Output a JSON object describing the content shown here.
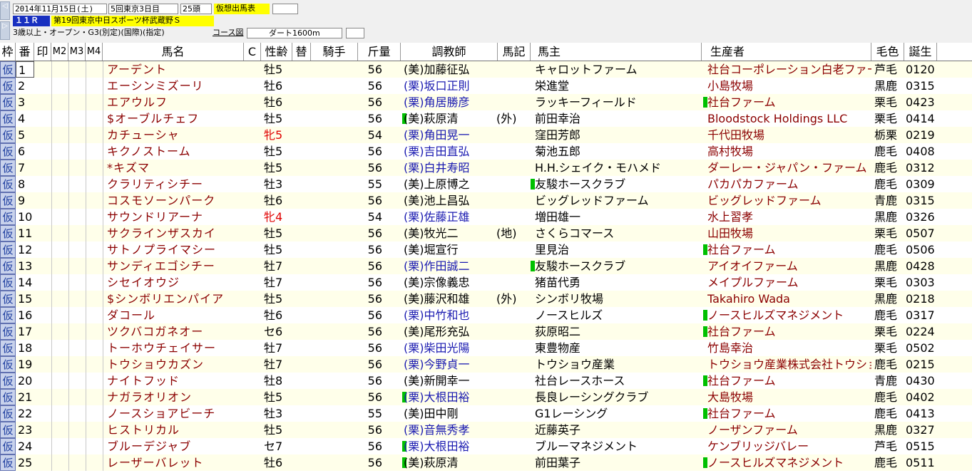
{
  "header": {
    "nav_left_top": "◁",
    "nav_left_bottom": "▷",
    "date": "2014年11月15日(土)",
    "meeting": "5回東京3日目",
    "runners": "25頭",
    "status_badge": "仮想出馬表",
    "race_no": "１１Ｒ",
    "race_name": "第19回東京中日スポーツ杯武蔵野Ｓ",
    "conditions": "3歳以上・オープン・G3(別定)(国際)(指定)",
    "course_label": "コース図",
    "course": "ダート1600m",
    "badge_color": "#ffff00",
    "race_color": "#1830c0"
  },
  "columns": [
    "枠",
    "番",
    "印",
    "M2",
    "M3",
    "M4",
    "馬名",
    "C",
    "性齢",
    "替",
    "騎手",
    "斤量",
    "調教師",
    "馬記",
    "馬主",
    "生産者",
    "毛色",
    "誕生"
  ],
  "rows": [
    {
      "waku": "仮",
      "ban": "1",
      "name": "アーデント",
      "sex": "牡5",
      "kin": "56",
      "g1": false,
      "trainer": "(美)加藤征弘",
      "tblue": false,
      "note": "",
      "owner": "キャロットファーム",
      "g2": false,
      "breeder": "社台コーポレーション白老ファー",
      "coat": "芦毛",
      "bday": "0120"
    },
    {
      "waku": "仮",
      "ban": "2",
      "name": "エーシンミズーリ",
      "sex": "牡6",
      "kin": "56",
      "g1": false,
      "trainer": "(栗)坂口正則",
      "tblue": true,
      "note": "",
      "owner": "栄進堂",
      "g2": false,
      "breeder": "小島牧場",
      "coat": "黒鹿",
      "bday": "0315"
    },
    {
      "waku": "仮",
      "ban": "3",
      "name": "エアウルフ",
      "sex": "牡6",
      "kin": "56",
      "g1": false,
      "trainer": "(栗)角居勝彦",
      "tblue": true,
      "note": "",
      "owner": "ラッキーフィールド",
      "g2": true,
      "breeder": "社台ファーム",
      "coat": "栗毛",
      "bday": "0423"
    },
    {
      "waku": "仮",
      "ban": "4",
      "name": "$オーブルチェフ",
      "sex": "牡5",
      "kin": "56",
      "g1": true,
      "trainer": "(美)萩原清",
      "tblue": false,
      "note": "(外)",
      "owner": "前田幸治",
      "g2": false,
      "breeder": "Bloodstock Holdings LLC",
      "coat": "栗毛",
      "bday": "0414"
    },
    {
      "waku": "仮",
      "ban": "5",
      "name": "カチューシャ",
      "sex": "牝5",
      "kin": "54",
      "g1": false,
      "trainer": "(栗)角田晃一",
      "tblue": true,
      "note": "",
      "owner": "窪田芳郎",
      "g2": false,
      "breeder": "千代田牧場",
      "coat": "栃栗",
      "bday": "0219"
    },
    {
      "waku": "仮",
      "ban": "6",
      "name": "キクノストーム",
      "sex": "牡5",
      "kin": "56",
      "g1": false,
      "trainer": "(栗)吉田直弘",
      "tblue": true,
      "note": "",
      "owner": "菊池五郎",
      "g2": false,
      "breeder": "高村牧場",
      "coat": "鹿毛",
      "bday": "0408"
    },
    {
      "waku": "仮",
      "ban": "7",
      "name": "*キズマ",
      "sex": "牡5",
      "kin": "56",
      "g1": false,
      "trainer": "(栗)白井寿昭",
      "tblue": true,
      "note": "",
      "owner": "H.H.シェイク・モハメド",
      "g2": false,
      "breeder": "ダーレー・ジャパン・ファーム",
      "coat": "鹿毛",
      "bday": "0312"
    },
    {
      "waku": "仮",
      "ban": "8",
      "name": "クラリティシチー",
      "sex": "牡3",
      "kin": "55",
      "g1": false,
      "trainer": "(美)上原博之",
      "tblue": false,
      "note": "",
      "owner": "友駿ホースクラブ",
      "g2": false,
      "g3": true,
      "breeder": "パカパカファーム",
      "coat": "鹿毛",
      "bday": "0309"
    },
    {
      "waku": "仮",
      "ban": "9",
      "name": "コスモソーンパーク",
      "sex": "牡6",
      "kin": "56",
      "g1": false,
      "trainer": "(美)池上昌弘",
      "tblue": false,
      "note": "",
      "owner": "ビッグレッドファーム",
      "g2": false,
      "breeder": "ビッグレッドファーム",
      "coat": "青鹿",
      "bday": "0315"
    },
    {
      "waku": "仮",
      "ban": "10",
      "name": "サウンドリアーナ",
      "sex": "牝4",
      "kin": "54",
      "g1": false,
      "trainer": "(栗)佐藤正雄",
      "tblue": true,
      "note": "",
      "owner": "増田雄一",
      "g2": false,
      "breeder": "水上習孝",
      "coat": "黒鹿",
      "bday": "0326"
    },
    {
      "waku": "仮",
      "ban": "11",
      "name": "サクラインザスカイ",
      "sex": "牡5",
      "kin": "56",
      "g1": false,
      "trainer": "(美)牧光二",
      "tblue": false,
      "note": "(地)",
      "owner": "さくらコマース",
      "g2": false,
      "breeder": "山田牧場",
      "coat": "栗毛",
      "bday": "0507"
    },
    {
      "waku": "仮",
      "ban": "12",
      "name": "サトノプライマシー",
      "sex": "牡5",
      "kin": "56",
      "g1": false,
      "trainer": "(美)堀宣行",
      "tblue": false,
      "note": "",
      "owner": "里見治",
      "g2": true,
      "breeder": "社台ファーム",
      "coat": "鹿毛",
      "bday": "0506"
    },
    {
      "waku": "仮",
      "ban": "13",
      "name": "サンディエゴシチー",
      "sex": "牡7",
      "kin": "56",
      "g1": false,
      "trainer": "(栗)作田誠二",
      "tblue": true,
      "note": "",
      "owner": "友駿ホースクラブ",
      "g2": false,
      "g3": true,
      "breeder": "アイオイファーム",
      "coat": "黒鹿",
      "bday": "0428"
    },
    {
      "waku": "仮",
      "ban": "14",
      "name": "シセイオウジ",
      "sex": "牡7",
      "kin": "56",
      "g1": false,
      "trainer": "(美)宗像義忠",
      "tblue": false,
      "note": "",
      "owner": "猪苗代勇",
      "g2": false,
      "breeder": "メイプルファーム",
      "coat": "栗毛",
      "bday": "0303"
    },
    {
      "waku": "仮",
      "ban": "15",
      "name": "$シンボリエンパイア",
      "sex": "牡5",
      "kin": "56",
      "g1": false,
      "trainer": "(美)藤沢和雄",
      "tblue": false,
      "note": "(外)",
      "owner": "シンボリ牧場",
      "g2": false,
      "breeder": "Takahiro Wada",
      "coat": "黒鹿",
      "bday": "0218"
    },
    {
      "waku": "仮",
      "ban": "16",
      "name": "ダコール",
      "sex": "牡6",
      "kin": "56",
      "g1": false,
      "trainer": "(栗)中竹和也",
      "tblue": true,
      "note": "",
      "owner": "ノースヒルズ",
      "g2": true,
      "breeder": "ノースヒルズマネジメント",
      "coat": "鹿毛",
      "bday": "0317"
    },
    {
      "waku": "仮",
      "ban": "17",
      "name": "ツクバコガネオー",
      "sex": "セ6",
      "kin": "56",
      "g1": false,
      "trainer": "(美)尾形充弘",
      "tblue": false,
      "note": "",
      "owner": "荻原昭二",
      "g2": true,
      "breeder": "社台ファーム",
      "coat": "栗毛",
      "bday": "0224"
    },
    {
      "waku": "仮",
      "ban": "18",
      "name": "トーホウチェイサー",
      "sex": "牡7",
      "kin": "56",
      "g1": false,
      "trainer": "(栗)柴田光陽",
      "tblue": true,
      "note": "",
      "owner": "東豊物産",
      "g2": false,
      "breeder": "竹島幸治",
      "coat": "栗毛",
      "bday": "0502"
    },
    {
      "waku": "仮",
      "ban": "19",
      "name": "トウショウカズン",
      "sex": "牡7",
      "kin": "56",
      "g1": false,
      "trainer": "(栗)今野貞一",
      "tblue": true,
      "note": "",
      "owner": "トウショウ産業",
      "g2": false,
      "breeder": "トウショウ産業株式会社トウショ",
      "coat": "鹿毛",
      "bday": "0215"
    },
    {
      "waku": "仮",
      "ban": "20",
      "name": "ナイトフッド",
      "sex": "牡8",
      "kin": "56",
      "g1": false,
      "trainer": "(美)新開幸一",
      "tblue": false,
      "note": "",
      "owner": "社台レースホース",
      "g2": true,
      "breeder": "社台ファーム",
      "coat": "青鹿",
      "bday": "0430"
    },
    {
      "waku": "仮",
      "ban": "21",
      "name": "ナガラオリオン",
      "sex": "牡5",
      "kin": "56",
      "g1": true,
      "trainer": "(栗)大根田裕",
      "tblue": true,
      "note": "",
      "owner": "長良レーシングクラブ",
      "g2": false,
      "breeder": "大島牧場",
      "coat": "鹿毛",
      "bday": "0402"
    },
    {
      "waku": "仮",
      "ban": "22",
      "name": "ノースショアビーチ",
      "sex": "牡3",
      "kin": "55",
      "g1": false,
      "trainer": "(美)田中剛",
      "tblue": false,
      "note": "",
      "owner": "G1レーシング",
      "g2": true,
      "breeder": "社台ファーム",
      "coat": "鹿毛",
      "bday": "0413"
    },
    {
      "waku": "仮",
      "ban": "23",
      "name": "ヒストリカル",
      "sex": "牡5",
      "kin": "56",
      "g1": false,
      "trainer": "(栗)音無秀孝",
      "tblue": true,
      "note": "",
      "owner": "近藤英子",
      "g2": false,
      "breeder": "ノーザンファーム",
      "coat": "黒鹿",
      "bday": "0327"
    },
    {
      "waku": "仮",
      "ban": "24",
      "name": "ブルーデジャブ",
      "sex": "セ7",
      "kin": "56",
      "g1": true,
      "trainer": "(栗)大根田裕",
      "tblue": true,
      "note": "",
      "owner": "ブルーマネジメント",
      "g2": false,
      "breeder": "ケンブリッジバレー",
      "coat": "芦毛",
      "bday": "0515"
    },
    {
      "waku": "仮",
      "ban": "25",
      "name": "レーザーバレット",
      "sex": "牡6",
      "kin": "56",
      "g1": true,
      "trainer": "(美)萩原清",
      "tblue": false,
      "note": "",
      "owner": "前田葉子",
      "g2": true,
      "breeder": "ノースヒルズマネジメント",
      "coat": "鹿毛",
      "bday": "0511"
    }
  ]
}
